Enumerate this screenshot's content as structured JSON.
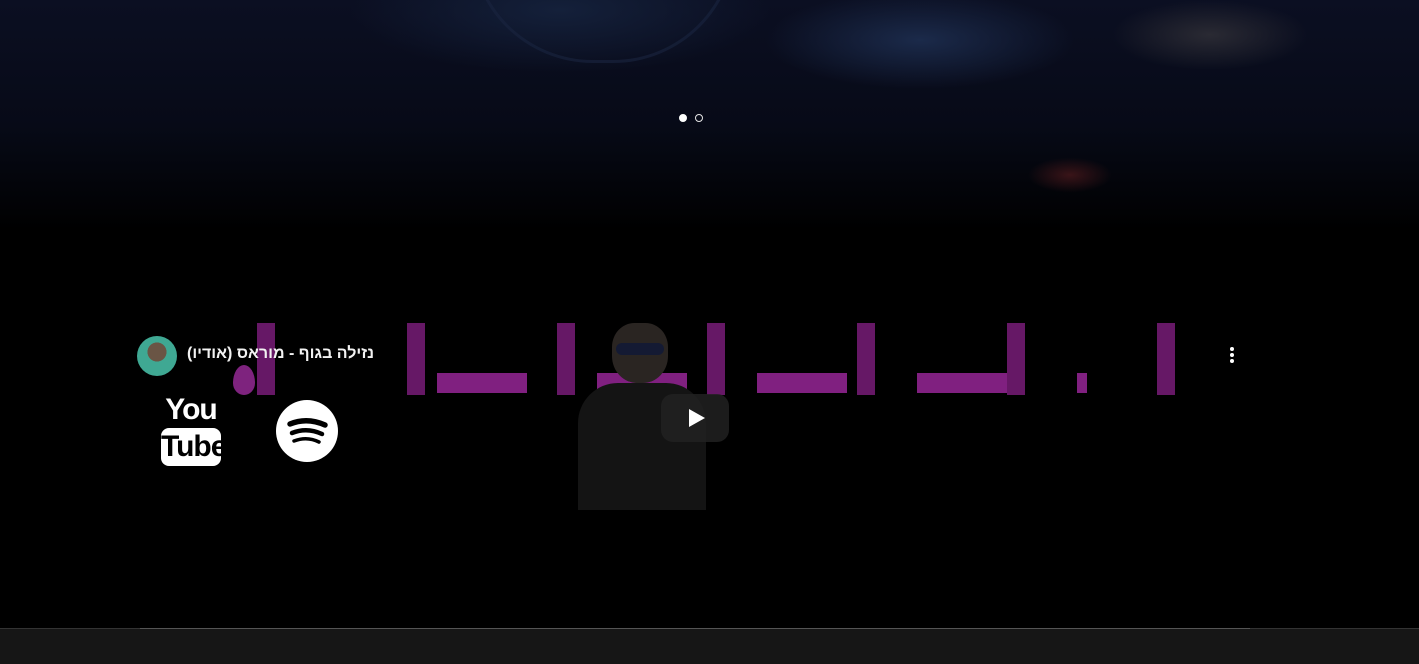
{
  "carousel": {
    "slides": [
      {
        "active": true
      },
      {
        "active": false
      }
    ]
  },
  "video": {
    "title": "נזילה בגוף - מוראס (אודיו)",
    "icons": {
      "avatar": "channel-avatar",
      "more": "more-vert-icon",
      "play": "play-icon"
    }
  },
  "links": {
    "youtube_line1": "You",
    "youtube_line2": "Tube",
    "spotify": "spotify-icon"
  }
}
